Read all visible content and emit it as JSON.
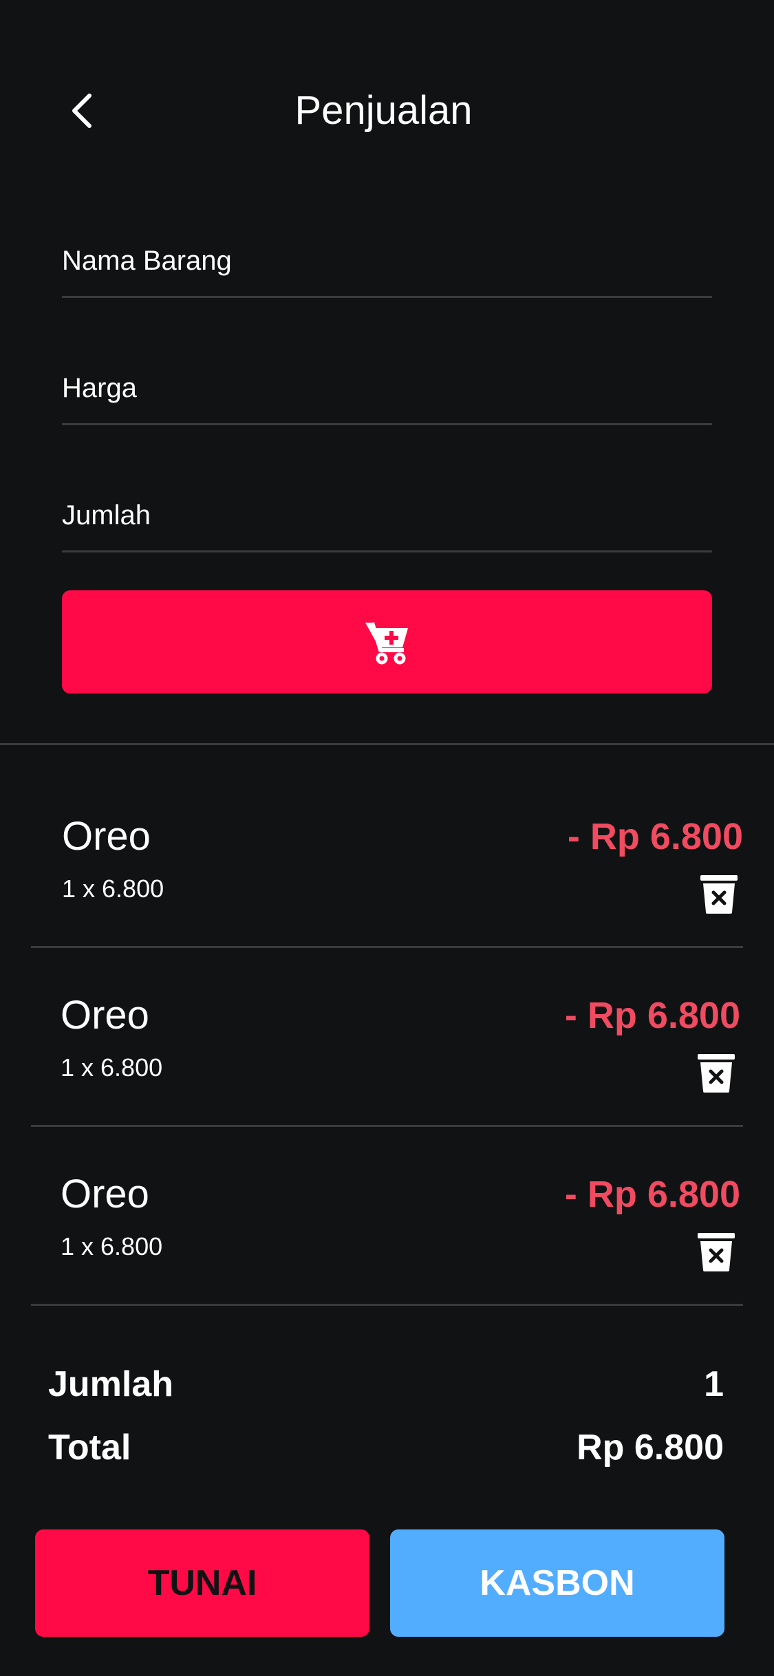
{
  "header": {
    "title": "Penjualan",
    "back_icon": "chevron-left-icon"
  },
  "form": {
    "name_placeholder": "Nama Barang",
    "price_placeholder": "Harga",
    "qty_placeholder": "Jumlah",
    "add_icon": "cart-plus-icon"
  },
  "items": [
    {
      "name": "Oreo",
      "qty": "1 x 6.800",
      "price": "- Rp 6.800",
      "delete_icon": "trash-x-icon"
    },
    {
      "name": "Oreo",
      "qty": "1 x 6.800",
      "price": "- Rp 6.800",
      "delete_icon": "trash-x-icon"
    },
    {
      "name": "Oreo",
      "qty": "1 x 6.800",
      "price": "- Rp 6.800",
      "delete_icon": "trash-x-icon"
    }
  ],
  "summary": {
    "jumlah_label": "Jumlah",
    "jumlah_value": "1",
    "total_label": "Total",
    "total_value": "Rp 6.800"
  },
  "actions": {
    "tunai_label": "TUNAI",
    "kasbon_label": "KASBON"
  },
  "colors": {
    "background": "#111214",
    "accent": "#ff0a46",
    "price_negative": "#f04b61",
    "kasbon": "#52adff",
    "divider": "#3a3b3e"
  }
}
